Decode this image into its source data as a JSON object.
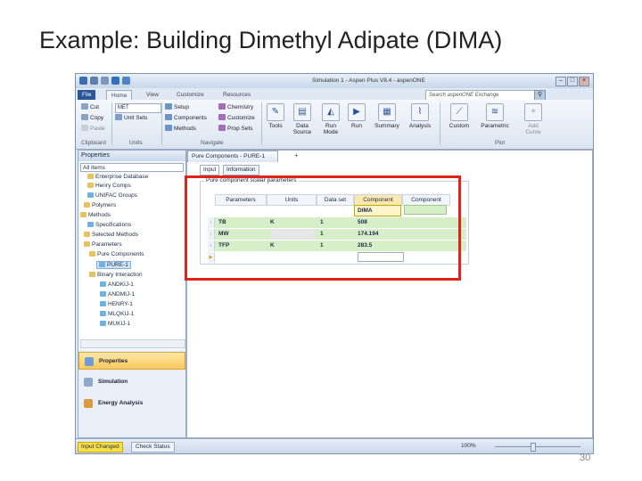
{
  "slide": {
    "title": "Example: Building Dimethyl Adipate (DIMA)",
    "page_number": "30"
  },
  "window": {
    "title": "Simulation 1 - Aspen Plus V8.4 - aspenONE",
    "search_placeholder": "Search aspenONE Exchange"
  },
  "ribbon": {
    "tabs": [
      "File",
      "Home",
      "View",
      "Customize",
      "Resources"
    ],
    "clipboard": {
      "cut": "Cut",
      "copy": "Copy",
      "paste": "Paste",
      "group": "Clipboard"
    },
    "units": {
      "select": "MET",
      "unit_sets": "Unit Sets",
      "group": "Units"
    },
    "navigate": {
      "setup": "Setup",
      "components": "Components",
      "methods": "Methods",
      "chemistry": "Chemistry",
      "customize": "Customize",
      "prop_sets": "Prop Sets",
      "group": "Navigate"
    },
    "tools": {
      "tools": "Tools",
      "data_source": "Data Source",
      "run_mode": "Run Mode",
      "run": "Run",
      "summary": "Summary",
      "analysis": "Analysis"
    },
    "plot": {
      "custom": "Custom",
      "parametric": "Parametric",
      "add_curve": "Add Curve",
      "group": "Plot"
    }
  },
  "nav": {
    "header": "Properties",
    "filter": "All Items",
    "tree": [
      "Enterprise Database",
      "Henry Comps",
      "UNIFAC Groups",
      "Polymers",
      "Methods",
      "Specifications",
      "Selected Methods",
      "Parameters",
      "Pure Components",
      "PURE-1",
      "Binary Interaction",
      "ANDKIJ-1",
      "ANDMIJ-1",
      "HENRY-1",
      "MLQKIJ-1",
      "MUKIJ-1"
    ],
    "buttons": [
      "Properties",
      "Simulation",
      "Energy Analysis"
    ]
  },
  "doc": {
    "tab": "Pure Components - PURE-1",
    "subtabs": [
      "Input",
      "Information"
    ],
    "legend": "Pure component scalar parameters",
    "headers": [
      "Parameters",
      "Units",
      "Data set",
      "Component",
      "Component"
    ],
    "component_select": "DIMA",
    "rows": [
      {
        "param": "TB",
        "unit": "K",
        "set": "1",
        "value": "508"
      },
      {
        "param": "MW",
        "unit": "",
        "set": "1",
        "value": "174.194"
      },
      {
        "param": "TFP",
        "unit": "K",
        "set": "1",
        "value": "283.5"
      }
    ]
  },
  "status": {
    "warning": "Input Changed",
    "check": "Check Status",
    "zoom": "100%"
  },
  "colors": {
    "highlight_box": "#e2231a",
    "row_green": "#d7efc8",
    "file_tab": "#2b5797",
    "status_warn": "#f8e04b"
  }
}
